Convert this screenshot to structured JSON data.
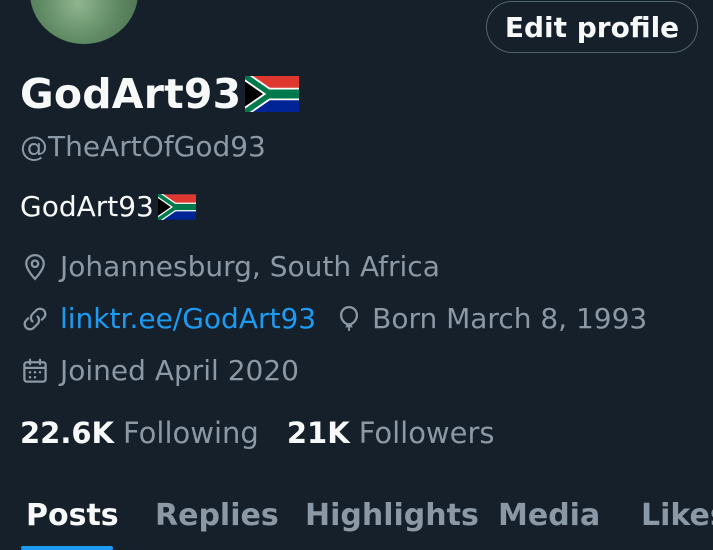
{
  "profile": {
    "display_name": "GodArt93",
    "handle": "@TheArtOfGod93",
    "bio_text": "GodArt93",
    "flag_icon": "south-africa-flag-icon",
    "location": "Johannesburg, South Africa",
    "website": "linktr.ee/GodArt93",
    "birthday": "Born March 8, 1993",
    "joined": "Joined April 2020"
  },
  "actions": {
    "edit_profile": "Edit profile"
  },
  "stats": {
    "following_count": "22.6K",
    "following_label": "Following",
    "followers_count": "21K",
    "followers_label": "Followers"
  },
  "tabs": [
    {
      "label": "Posts",
      "active": true
    },
    {
      "label": "Replies",
      "active": false
    },
    {
      "label": "Highlights",
      "active": false
    },
    {
      "label": "Media",
      "active": false
    },
    {
      "label": "Likes",
      "active": false
    }
  ],
  "colors": {
    "background": "#15202b",
    "text_primary": "#f7f9f9",
    "text_secondary": "#8b98a5",
    "accent": "#1d9bf0",
    "border": "#536471"
  }
}
